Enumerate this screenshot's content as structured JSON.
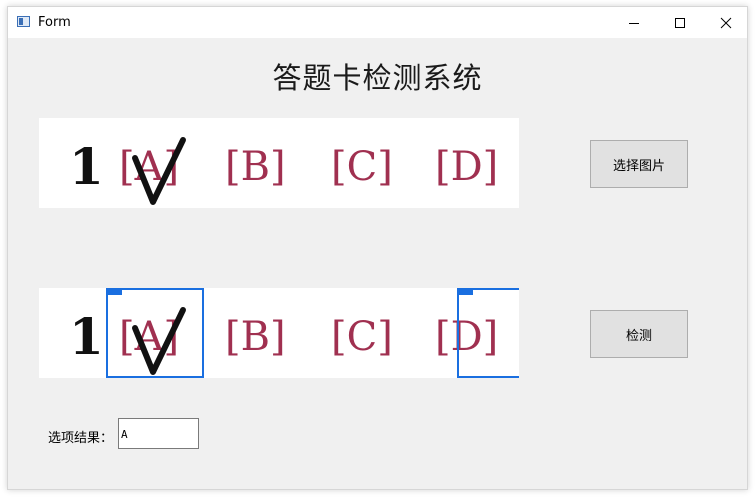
{
  "window": {
    "title": "Form"
  },
  "heading": "答题卡检测系统",
  "buttons": {
    "select_image": "选择图片",
    "detect": "检测"
  },
  "sheet": {
    "question_number": "1",
    "options": [
      "[A]",
      "[B]",
      "[C]",
      "[D]"
    ],
    "ink_color": "#a03050",
    "mark_color": "#111111"
  },
  "detection": {
    "box_color": "#1a6fe0",
    "boxed_options": [
      "A",
      "D"
    ]
  },
  "result": {
    "label": "选项结果：",
    "value": "A"
  },
  "icons": {
    "app": "app-window-icon",
    "minimize": "minimize-icon",
    "maximize": "maximize-icon",
    "close": "close-icon",
    "checkmark": "checkmark-icon"
  }
}
